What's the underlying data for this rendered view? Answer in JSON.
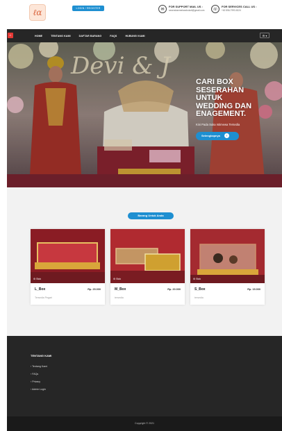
{
  "header": {
    "logo_text": "ℓα",
    "login_label": "LOGIN / REGISTER",
    "support": {
      "title": "FOR SUPPORT MAIL US :",
      "value": "seserahanmeiseabokoti@gmail.com"
    },
    "services": {
      "title": "FOR SERVICES CALL US :",
      "value": "+62 856-7993-8124"
    }
  },
  "nav": {
    "items": [
      "HOME",
      "TENTANG KAMI",
      "DAFTAR BARANG",
      "FAQS",
      "HUBUNGI KAMI"
    ],
    "user_label": "⚙ ▾"
  },
  "hero": {
    "title_lines": [
      "CARI BOX",
      "SESERAHAN",
      "UNTUK",
      "WEDDING DAN",
      "ENAGEMENT."
    ],
    "subtitle": "Kini Pada Suka Istimewa Tersedia",
    "button_label": "Selengkapnya"
  },
  "products": {
    "section_label": "Barang Untuk Anda",
    "cards": [
      {
        "name": "L_Box",
        "price": "Rp. 25.000",
        "desc": "Tersedia Pegari",
        "badge": "Stok"
      },
      {
        "name": "M_Box",
        "price": "Rp. 20.000",
        "desc": "tersedia",
        "badge": "Stok"
      },
      {
        "name": "S_Box",
        "price": "Rp. 15.000",
        "desc": "tersedia",
        "badge": "Stok"
      }
    ]
  },
  "footer": {
    "heading": "TENTANG KAMI",
    "links": [
      "Tentang Kami",
      "FAQs",
      "Privacy",
      "Admin Login"
    ],
    "copyright": "Copyright © 2021"
  },
  "colors": {
    "accent": "#1e8fd1",
    "dark": "#262626",
    "nav_icon": "#e53935"
  }
}
